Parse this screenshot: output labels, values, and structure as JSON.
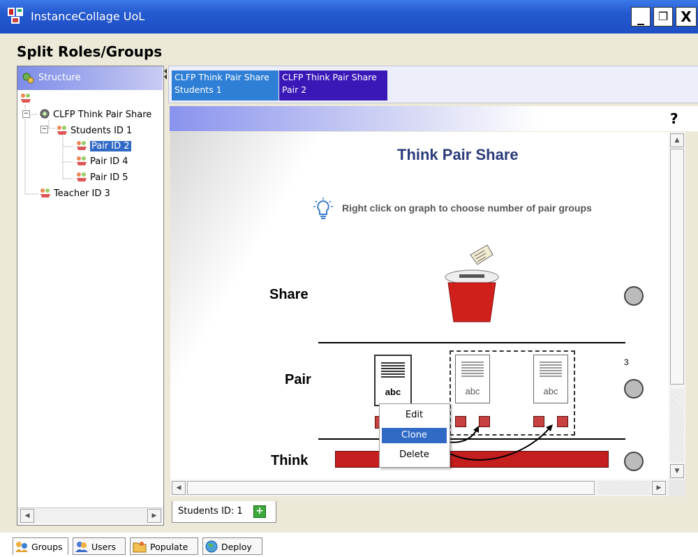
{
  "window": {
    "title": "InstanceCollage UoL",
    "minimize_label": "_",
    "restore_label": "❐",
    "close_label": "X"
  },
  "heading": "Split Roles/Groups",
  "structure_panel": {
    "header": "Structure",
    "tree": [
      {
        "label": "CLFP Think Pair Share",
        "expander": "−"
      },
      {
        "label": "Students ID 1",
        "expander": "−"
      },
      {
        "label": "Pair ID 2",
        "selected": true
      },
      {
        "label": "Pair ID 4"
      },
      {
        "label": "Pair ID 5"
      },
      {
        "label": "Teacher ID 3"
      }
    ],
    "scroll_left": "◀",
    "scroll_right": "▶"
  },
  "top_tabs": [
    {
      "line1": "CLFP Think Pair Share",
      "line2": "Students 1",
      "color": "#2f7fd6"
    },
    {
      "line1": "CLFP Think Pair Share",
      "line2": "Pair 2",
      "color": "#3a18b8"
    }
  ],
  "help_label": "?",
  "canvas": {
    "title": "Think Pair Share",
    "hint": "Right click on graph to choose number of pair groups",
    "levels": [
      "Share",
      "Pair",
      "Think"
    ],
    "pair_count": "3",
    "doc_label": "abc",
    "accent_red": "#c41e1e",
    "title_color": "#2a3a7a"
  },
  "context_menu": {
    "items": [
      "Edit",
      "Clone",
      "Delete"
    ],
    "highlighted": "Clone"
  },
  "bottom_tab": {
    "label": "Students ID: 1",
    "add_label": "+"
  },
  "status_tabs": [
    "Groups",
    "Users",
    "Populate",
    "Deploy"
  ],
  "scroll": {
    "up": "▲",
    "down": "▼",
    "left": "◀",
    "right": "▶"
  }
}
